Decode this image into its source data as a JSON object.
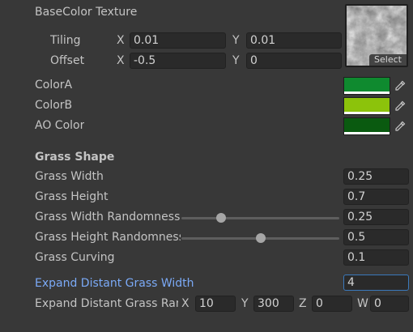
{
  "texture": {
    "label": "BaseColor Texture",
    "select_label": "Select",
    "tiling": {
      "label": "Tiling",
      "x_axis": "X",
      "x": "0.01",
      "y_axis": "Y",
      "y": "0.01"
    },
    "offset": {
      "label": "Offset",
      "x_axis": "X",
      "x": "-0.5",
      "y_axis": "Y",
      "y": "0"
    }
  },
  "colors": [
    {
      "label": "ColorA",
      "value": "#0f8a2f",
      "icon": "eyedropper-icon"
    },
    {
      "label": "ColorB",
      "value": "#8cc30b",
      "icon": "eyedropper-icon"
    },
    {
      "label": "AO Color",
      "value": "#0a5a10",
      "icon": "eyedropper-icon"
    }
  ],
  "grass_shape": {
    "header": "Grass Shape",
    "grass_width": {
      "label": "Grass Width",
      "value": "0.25"
    },
    "grass_height": {
      "label": "Grass Height",
      "value": "0.7"
    },
    "width_randomness": {
      "label": "Grass Width Randomness",
      "value": "0.25",
      "slider_fraction": 0.25
    },
    "height_randomness": {
      "label": "Grass Height Randomness",
      "value": "0.5",
      "slider_fraction": 0.5
    },
    "grass_curving": {
      "label": "Grass Curving",
      "value": "0.1"
    },
    "expand_width": {
      "label": "Expand Distant Grass Width",
      "value": "4"
    },
    "expand_range": {
      "label": "Expand Distant Grass Range",
      "x_axis": "X",
      "x": "10",
      "y_axis": "Y",
      "y": "300",
      "z_axis": "Z",
      "z": "0",
      "w_axis": "W",
      "w": "0"
    }
  }
}
